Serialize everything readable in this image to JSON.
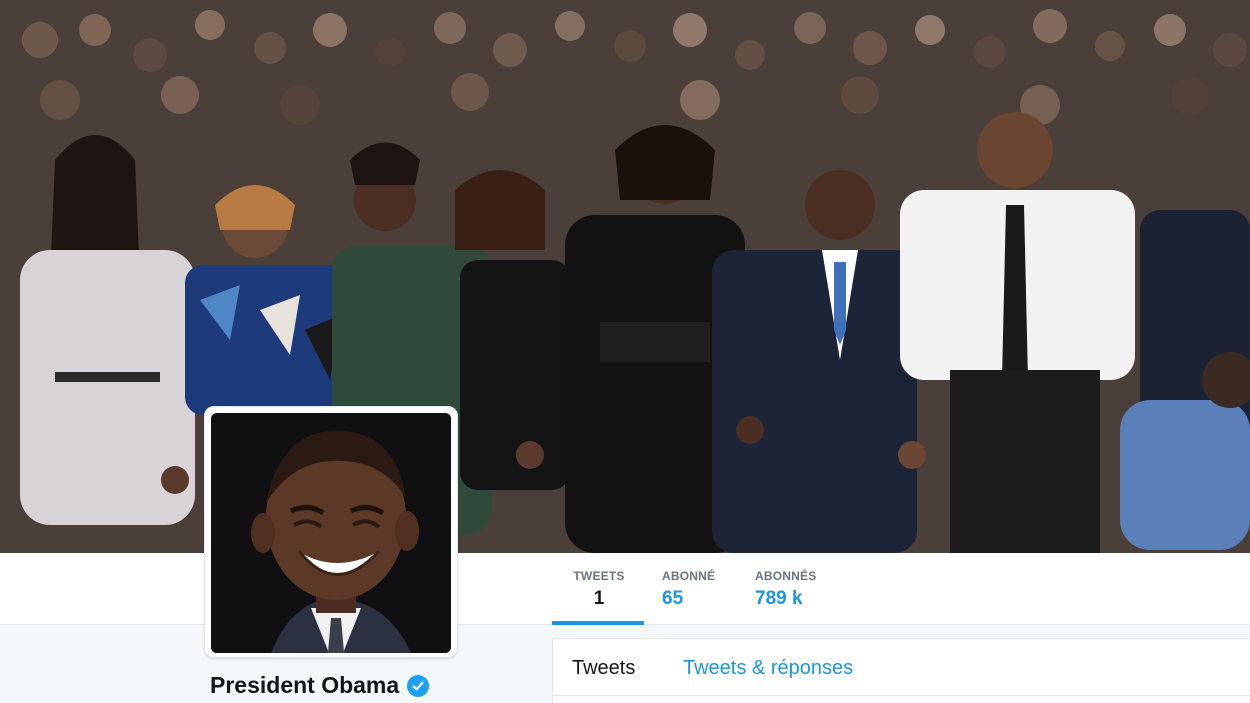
{
  "header": {
    "photo_icon": "crowd-march-photo"
  },
  "profile": {
    "name": "President Obama",
    "verified_icon": "verified-badge-icon",
    "avatar_icon": "profile-portrait"
  },
  "stats": [
    {
      "label": "TWEETS",
      "value": "1",
      "active": true
    },
    {
      "label": "ABONNÉ",
      "value": "65",
      "active": false
    },
    {
      "label": "ABONNÉS",
      "value": "789 k",
      "active": false
    }
  ],
  "timeline_tabs": [
    {
      "label": "Tweets",
      "active": true
    },
    {
      "label": "Tweets & réponses",
      "active": false
    }
  ],
  "colors": {
    "accent": "#1b95e0",
    "verified": "#1da1f2",
    "text": "#14171a",
    "muted": "#66757f"
  }
}
